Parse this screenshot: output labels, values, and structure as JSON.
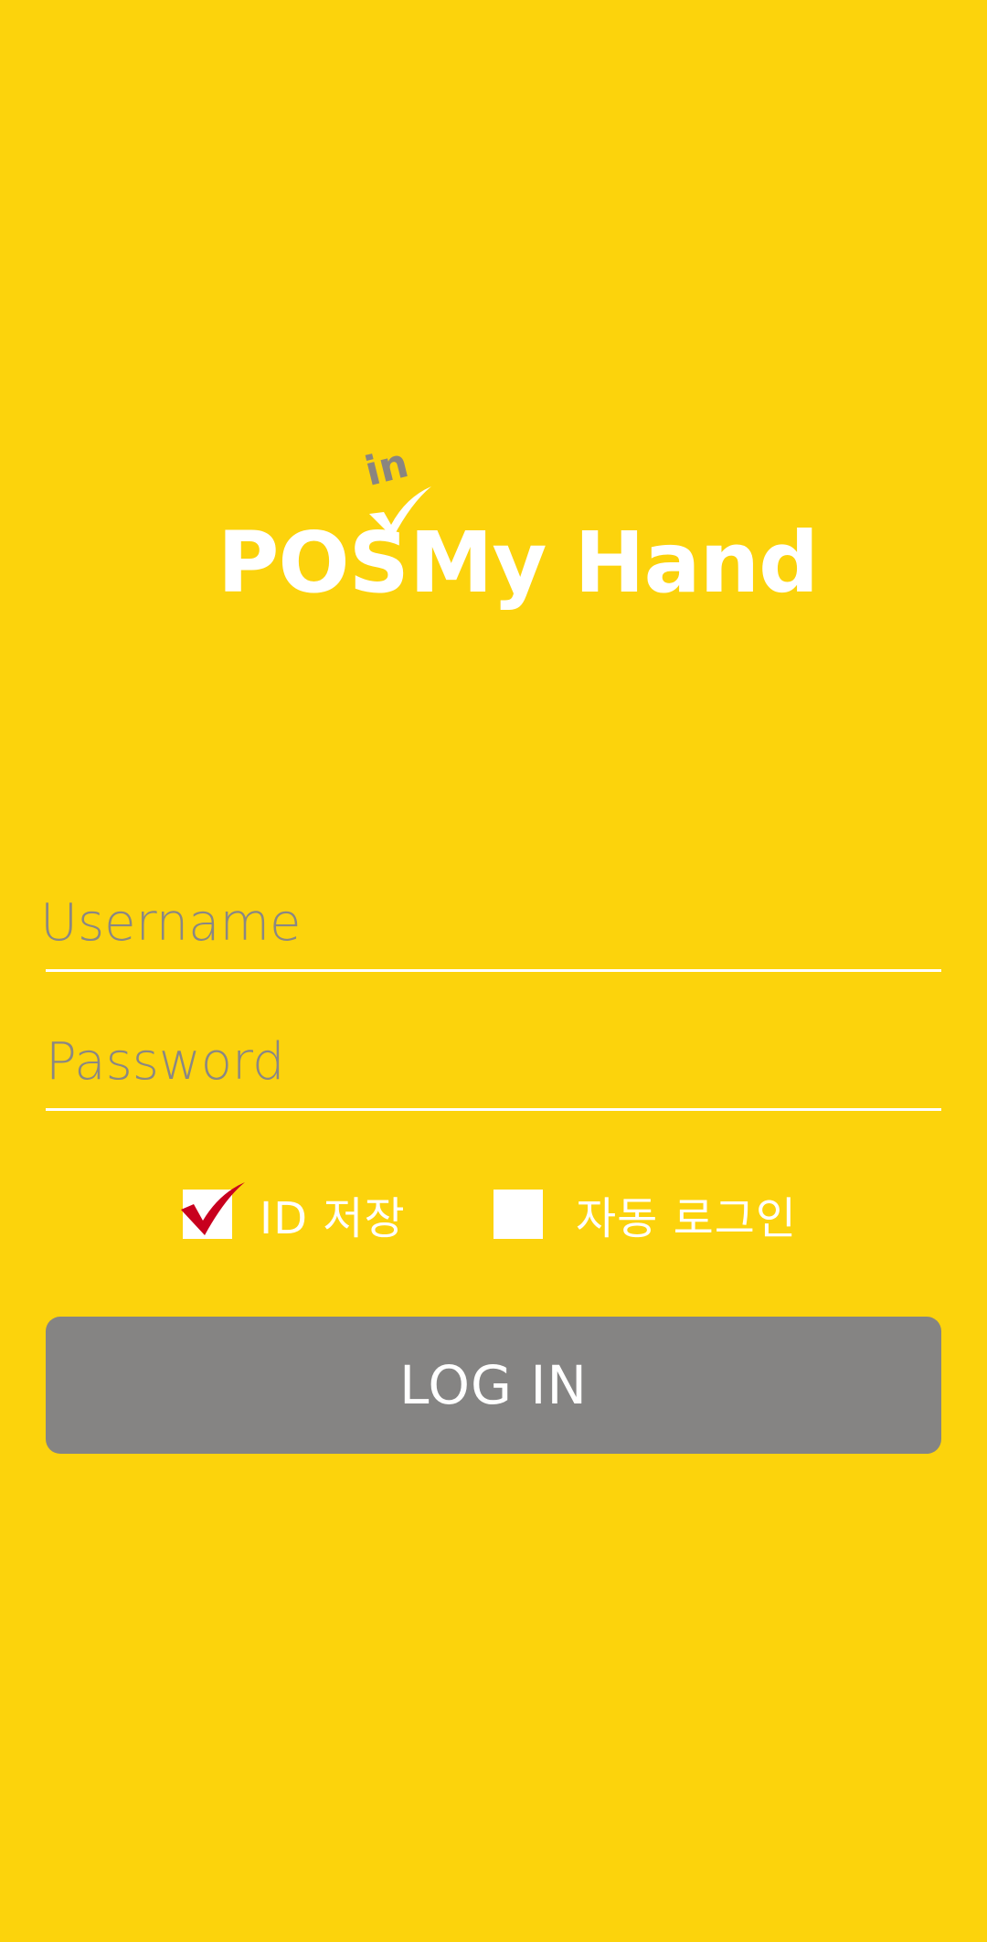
{
  "logo": {
    "pos": "POS",
    "in": "in",
    "rest": "My Hand",
    "accent_color": "#8A8580"
  },
  "form": {
    "username_placeholder": "Username",
    "username_value": "",
    "password_placeholder": "Password",
    "password_value": ""
  },
  "options": {
    "save_id_label": "ID 저장",
    "save_id_checked": true,
    "auto_login_label": "자동 로그인",
    "auto_login_checked": false
  },
  "button": {
    "login_label": "LOG IN"
  },
  "colors": {
    "background": "#FCD30C",
    "button": "#858483",
    "check_mark": "#C8001E",
    "text": "#FFFFFF"
  }
}
